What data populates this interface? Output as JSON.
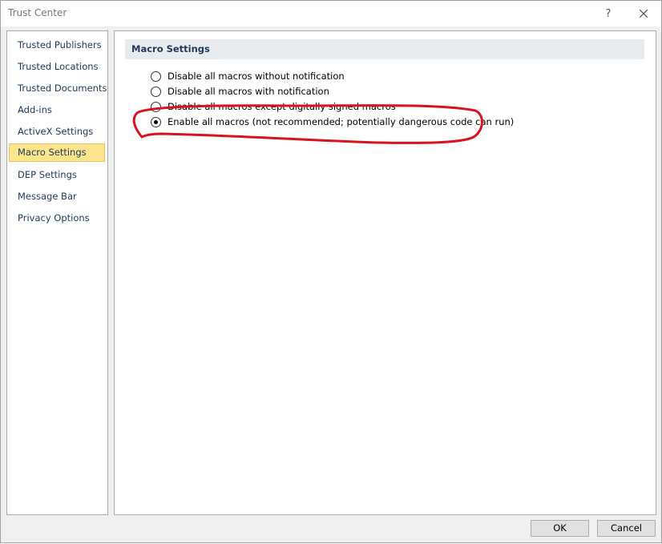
{
  "window": {
    "title": "Trust Center",
    "help_glyph": "?"
  },
  "sidebar": {
    "items": [
      {
        "label": "Trusted Publishers"
      },
      {
        "label": "Trusted Locations"
      },
      {
        "label": "Trusted Documents"
      },
      {
        "label": "Add-ins"
      },
      {
        "label": "ActiveX Settings"
      },
      {
        "label": "Macro Settings",
        "selected": true
      },
      {
        "label": "DEP Settings"
      },
      {
        "label": "Message Bar"
      },
      {
        "label": "Privacy Options"
      }
    ]
  },
  "main": {
    "section_title": "Macro Settings",
    "options": [
      {
        "label": "Disable all macros without notification",
        "checked": false
      },
      {
        "label": "Disable all macros with notification",
        "checked": false
      },
      {
        "label": "Disable all macros except digitally signed macros",
        "checked": false
      },
      {
        "label": "Enable all macros (not recommended; potentially dangerous code can run)",
        "checked": true
      }
    ]
  },
  "footer": {
    "ok_label": "OK",
    "cancel_label": "Cancel"
  },
  "colors": {
    "selected_nav_bg": "#fde58d",
    "annotation_red": "#d9121f"
  },
  "icons": {
    "help": "question-mark-icon",
    "close": "close-icon"
  }
}
